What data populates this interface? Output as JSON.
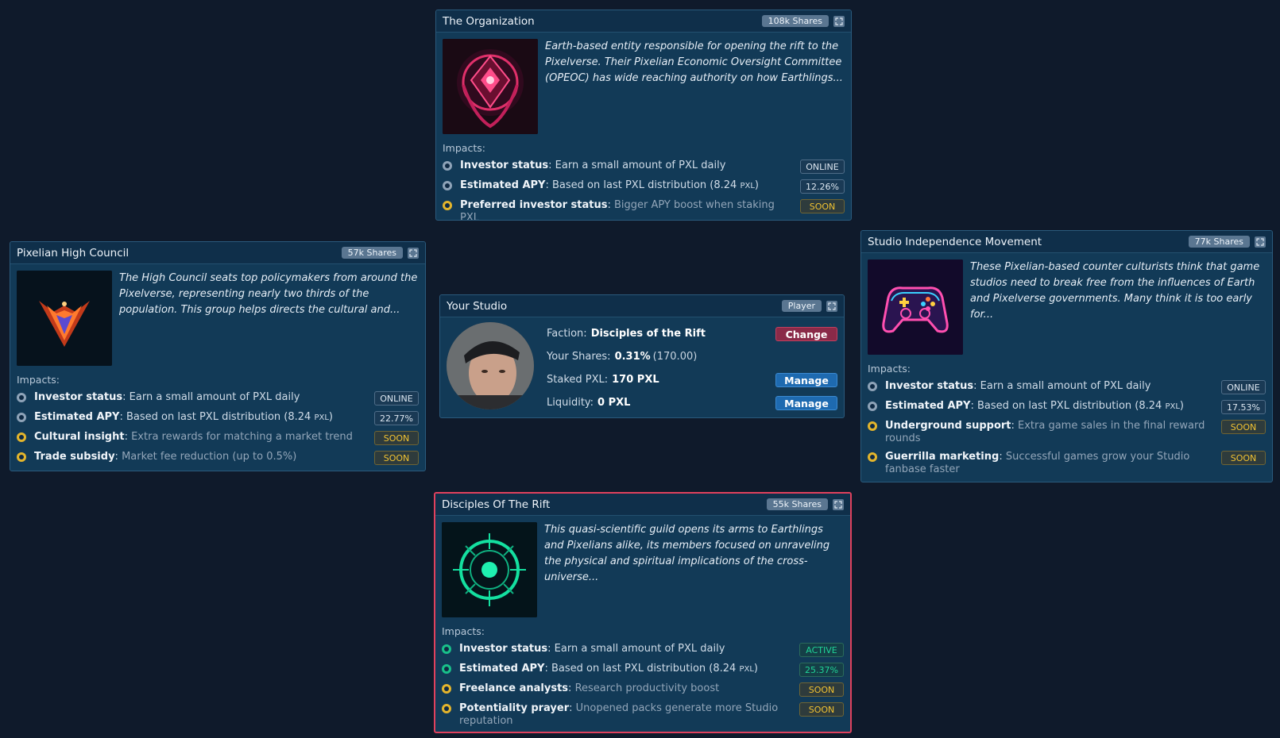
{
  "org": {
    "title": "The Organization",
    "shares": "108k Shares",
    "description": "Earth-based entity responsible for opening the rift to the Pixelverse. Their Pixelian Economic Oversight Committee (OPEOC) has wide reaching authority on how Earthlings...",
    "impacts_label": "Impacts:",
    "impacts": [
      {
        "name": "Investor status",
        "sep": ": ",
        "text": "Earn a small amount of PXL daily",
        "suffix": "",
        "status": "ONLINE"
      },
      {
        "name": "Estimated APY",
        "sep": ": ",
        "text": "Based on last PXL distribution (8.24 ",
        "suffix": "PXL",
        "close": ")",
        "status": "12.26%"
      },
      {
        "name": "Preferred investor status",
        "sep": ": ",
        "text": "Bigger APY boost when staking PXL",
        "suffix": "",
        "status": "SOON"
      }
    ]
  },
  "council": {
    "title": "Pixelian High Council",
    "shares": "57k Shares",
    "description": "The High Council seats top policymakers from around the Pixelverse, representing nearly two thirds of the population. This group helps directs the cultural and...",
    "impacts_label": "Impacts:",
    "impacts": [
      {
        "name": "Investor status",
        "sep": ": ",
        "text": "Earn a small amount of PXL daily",
        "status": "ONLINE"
      },
      {
        "name": "Estimated APY",
        "sep": ": ",
        "text": "Based on last PXL distribution (8.24 ",
        "suffix": "PXL",
        "close": ")",
        "status": "22.77%"
      },
      {
        "name": "Cultural insight",
        "sep": ": ",
        "text": "Extra rewards for matching a market trend",
        "status": "SOON"
      },
      {
        "name": "Trade subsidy",
        "sep": ": ",
        "text": "Market fee reduction (up to 0.5%)",
        "status": "SOON"
      }
    ]
  },
  "studio": {
    "title": "Your Studio",
    "badge": "Player",
    "faction_label": "Faction:",
    "faction_value": "Disciples of the Rift",
    "change_label": "Change",
    "shares_label": "Your Shares:",
    "shares_value": "0.31%",
    "shares_extra": "(170.00)",
    "staked_label": "Staked PXL:",
    "staked_value": "170 PXL",
    "liquidity_label": "Liquidity:",
    "liquidity_value": "0 PXL",
    "manage_label": "Manage"
  },
  "sim": {
    "title": "Studio Independence Movement",
    "shares": "77k Shares",
    "description": "These Pixelian-based counter culturists think that game studios need to break free from the influences of Earth and Pixelverse governments. Many think it is too early for...",
    "impacts_label": "Impacts:",
    "impacts": [
      {
        "name": "Investor status",
        "sep": ": ",
        "text": "Earn a small amount of PXL daily",
        "status": "ONLINE"
      },
      {
        "name": "Estimated APY",
        "sep": ": ",
        "text": "Based on last PXL distribution (8.24 ",
        "suffix": "PXL",
        "close": ")",
        "status": "17.53%"
      },
      {
        "name": "Underground support",
        "sep": ": ",
        "text": "Extra game sales in the final reward rounds",
        "status": "SOON"
      },
      {
        "name": "Guerrilla marketing",
        "sep": ": ",
        "text": "Successful games grow your Studio fanbase faster",
        "status": "SOON"
      }
    ]
  },
  "disciples": {
    "title": "Disciples Of The Rift",
    "shares": "55k Shares",
    "description": "This quasi-scientific guild opens its arms to Earthlings and Pixelians alike, its members focused on unraveling the physical and spiritual implications of the cross-universe...",
    "impacts_label": "Impacts:",
    "impacts": [
      {
        "name": "Investor status",
        "sep": ": ",
        "text": "Earn a small amount of PXL daily",
        "status": "ACTIVE"
      },
      {
        "name": "Estimated APY",
        "sep": ": ",
        "text": "Based on last PXL distribution (8.24 ",
        "suffix": "PXL",
        "close": ")",
        "status": "25.37%"
      },
      {
        "name": "Freelance analysts",
        "sep": ": ",
        "text": "Research productivity boost",
        "status": "SOON"
      },
      {
        "name": "Potentiality prayer",
        "sep": ": ",
        "text": "Unopened packs generate more Studio reputation",
        "status": "SOON"
      }
    ]
  },
  "colors": {
    "background": "#0f1a2b",
    "card": "#123a57",
    "active_border": "#e0415d",
    "soon": "#f1c232",
    "active": "#1fd397"
  }
}
